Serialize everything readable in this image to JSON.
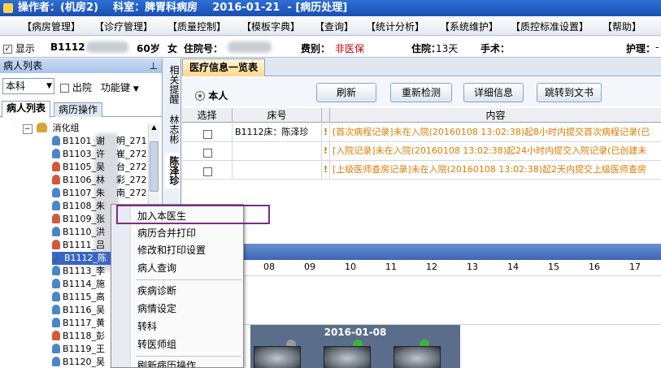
{
  "title_bar": {
    "operator_label": "操作者：",
    "operator_value": "(机房2)",
    "dept_label": "科室：",
    "dept_value": "脾胃科病房",
    "date": "2016-01-21",
    "mode": "- [病历处理]"
  },
  "menu": {
    "items": [
      "【病房管理】",
      "【诊疗管理】",
      "【质量控制】",
      "【模板字典】",
      "【查询】",
      "【统计分析】",
      "【系统维护】",
      "【质控标准设置】",
      "【帮助】"
    ]
  },
  "patient_info": {
    "show_label": "显示",
    "bed": "B1112",
    "age": "60岁",
    "sex": "女",
    "admission_label": "住院号：",
    "fee_label": "费别：",
    "fee_value": "非医保",
    "stay_label": "住院：",
    "stay_value": "13天",
    "surgery_label": "手术：",
    "nursing_label": "护理：",
    "nursing_value": "-"
  },
  "left_panel": {
    "header": "病人列表",
    "pin_icon": "pin-icon",
    "dept_select": "本科",
    "discharged_label": "出院",
    "function_key_label": "功能键",
    "tabs": [
      "病人列表",
      "病历操作"
    ],
    "group": "消化组",
    "patients": [
      {
        "bed": "B1101_谢",
        "suffix": "明_271",
        "sex": "m"
      },
      {
        "bed": "B1103_许",
        "suffix": "崔_272",
        "sex": "m"
      },
      {
        "bed": "B1105_吴",
        "suffix": "台_272",
        "sex": "f"
      },
      {
        "bed": "B1106_林",
        "suffix": "彩_272",
        "sex": "f"
      },
      {
        "bed": "B1107_朱",
        "suffix": "南_272",
        "sex": "m"
      },
      {
        "bed": "B1108_朱",
        "suffix": "",
        "sex": "m"
      },
      {
        "bed": "B1109_张",
        "suffix": "",
        "sex": "f"
      },
      {
        "bed": "B1110_洪",
        "suffix": "",
        "sex": "m"
      },
      {
        "bed": "B1111_吕",
        "suffix": "",
        "sex": "f"
      },
      {
        "bed": "B1112_陈",
        "suffix": "",
        "sex": "check"
      },
      {
        "bed": "B1113_李",
        "suffix": "",
        "sex": "m"
      },
      {
        "bed": "B1114_施",
        "suffix": "",
        "sex": "m"
      },
      {
        "bed": "B1115_高",
        "suffix": "",
        "sex": "m"
      },
      {
        "bed": "B1116_吴",
        "suffix": "",
        "sex": "m"
      },
      {
        "bed": "B1117_黄",
        "suffix": "",
        "sex": "m"
      },
      {
        "bed": "B1118_彭",
        "suffix": "",
        "sex": "f"
      },
      {
        "bed": "B1119_王",
        "suffix": "",
        "sex": "m"
      },
      {
        "bed": "B1120_吴",
        "suffix": "",
        "sex": "m"
      }
    ]
  },
  "side_tabs": [
    "相关提醒",
    "林志彬",
    "陈泽珍"
  ],
  "main": {
    "tab_title": "医疗信息一览表",
    "radio_label": "本人",
    "buttons": [
      "刷新",
      "重新检测",
      "详细信息",
      "跳转到文书"
    ],
    "columns": [
      "选择",
      "床号",
      "内容"
    ],
    "rows": [
      {
        "bed": "B1112床：陈泽珍",
        "content": "[首次病程记录]未在入院(20160108  13:02:38)起8小时内提交首次病程记录(已"
      },
      {
        "bed": "",
        "content": "[入院记录]未在入院(20160108  13:02:38)起24小时内提交入院记录(已创建未"
      },
      {
        "bed": "",
        "content": "[上级医师查房记录]未在入院(20160108  13:02:38)起2天内提交上级医师查房"
      }
    ],
    "warn_icon": "!",
    "hours": [
      "08",
      "09",
      "10",
      "11",
      "12",
      "13",
      "14",
      "15",
      "16",
      "17"
    ],
    "film_date": "2016-01-08"
  },
  "context_menu": {
    "items": [
      "加入本医生",
      "病历合并打印",
      "修改和打印设置",
      "病人查询",
      "疾病诊断",
      "病情设定",
      "转科",
      "转医师组",
      "刷新病历操作"
    ]
  }
}
